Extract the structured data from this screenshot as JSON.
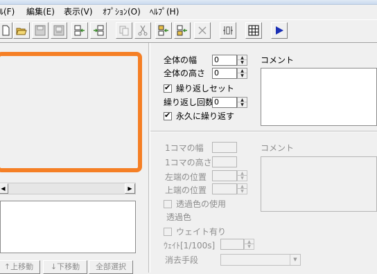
{
  "menu": {
    "file": "ﾙ(F)",
    "edit": "編集(E)",
    "view": "表示(V)",
    "options": "ｵﾌﾟｼｮﾝ(O)",
    "help": "ﾍﾙﾌﾟ(H)"
  },
  "toolbar": {
    "icons": [
      "new-icon",
      "open-icon",
      "save-icon",
      "save-all-icon",
      "insert-left-icon",
      "insert-right-icon",
      "copy-icon",
      "cut-icon",
      "paste-before-icon",
      "paste-after-icon",
      "delete-icon",
      "resize-icon",
      "grid-icon",
      "play-icon"
    ]
  },
  "anim": {
    "width_label": "全体の幅",
    "width_value": "0",
    "height_label": "全体の高さ",
    "height_value": "0",
    "loop_set_label": "繰り返しセット",
    "loop_set_checked": true,
    "loop_count_label": "繰り返し回数",
    "loop_count_value": "0",
    "forever_label": "永久に繰り返す",
    "forever_checked": true,
    "comment_label": "コメント"
  },
  "frame": {
    "width_label": "1コマの幅",
    "height_label": "1コマの高さ",
    "left_label": "左端の位置",
    "top_label": "上端の位置",
    "transparent_use_label": "透過色の使用",
    "transparent_label": "透過色",
    "wait_label": "ウェイト有り",
    "wait_value_label": "ｳｪｲﾄ[1/100s]",
    "dispose_label": "消去手段",
    "comment_label": "コメント"
  },
  "list_buttons": {
    "up": "↑上移動",
    "down": "↓下移動",
    "select_all": "全部選択"
  },
  "colors": {
    "preview_border": "#f57f25",
    "play_arrow": "#1a2fb5"
  }
}
